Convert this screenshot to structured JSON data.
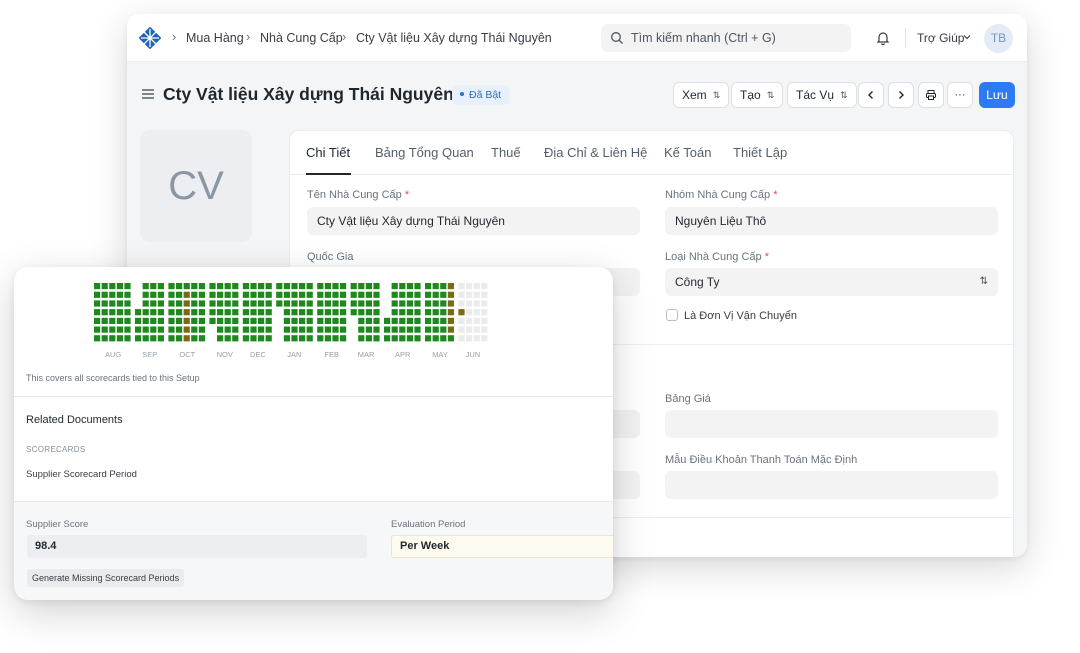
{
  "navbar": {
    "breadcrumbs": [
      "Mua Hàng",
      "Nhà Cung Cấp",
      "Cty Vật liệu Xây dựng Thái Nguyên"
    ],
    "search_placeholder": "Tìm kiếm nhanh (Ctrl + G)",
    "help_label": "Trợ Giúp",
    "avatar_initials": "TB"
  },
  "header": {
    "title": "Cty Vật liệu Xây dựng Thái Nguyên",
    "status": "Đã Bật",
    "buttons": {
      "view": "Xem",
      "create": "Tạo",
      "actions": "Tác Vụ",
      "more": "···",
      "save": "Lưu"
    }
  },
  "sidebar": {
    "avatar_initials": "CV"
  },
  "tabs": [
    "Chi Tiết",
    "Bảng Tổng Quan",
    "Thuế",
    "Địa Chỉ & Liên Hệ",
    "Kế Toán",
    "Thiết Lập"
  ],
  "form": {
    "supplier_name": {
      "label": "Tên Nhà Cung Cấp",
      "value": "Cty Vật liệu Xây dựng Thái Nguyên",
      "required": "*"
    },
    "supplier_group": {
      "label": "Nhóm Nhà Cung Cấp",
      "value": "Nguyên Liệu Thô",
      "required": "*"
    },
    "country": {
      "label": "Quốc Gia",
      "value": ""
    },
    "supplier_type": {
      "label": "Loại Nhà Cung Cấp",
      "value": "Công Ty",
      "required": "*"
    },
    "transporter": {
      "label": "Là Đơn Vị Vận Chuyển"
    },
    "price_list": {
      "label": "Bảng Giá",
      "value": ""
    },
    "payment_terms": {
      "label": "Mẫu Điều Khoản Thanh Toán Mặc Định",
      "value": ""
    }
  },
  "scorecard": {
    "months": [
      "AUG",
      "SEP",
      "OCT",
      "NOV",
      "DEC",
      "JAN",
      "FEB",
      "MAR",
      "APR",
      "MAY",
      "JUN"
    ],
    "note": "This covers all scorecards tied to this Setup",
    "related_title": "Related Documents",
    "related_section": "SCORECARDS",
    "related_link": "Supplier Scorecard Period",
    "score_label": "Supplier Score",
    "score_value": "98.4",
    "period_label": "Evaluation Period",
    "period_value": "Per Week",
    "generate_button": "Generate Missing Scorecard Periods",
    "colors": {
      "good": "#1e8a1e",
      "warn": "#7a6a14",
      "empty": "#ebebeb"
    }
  }
}
